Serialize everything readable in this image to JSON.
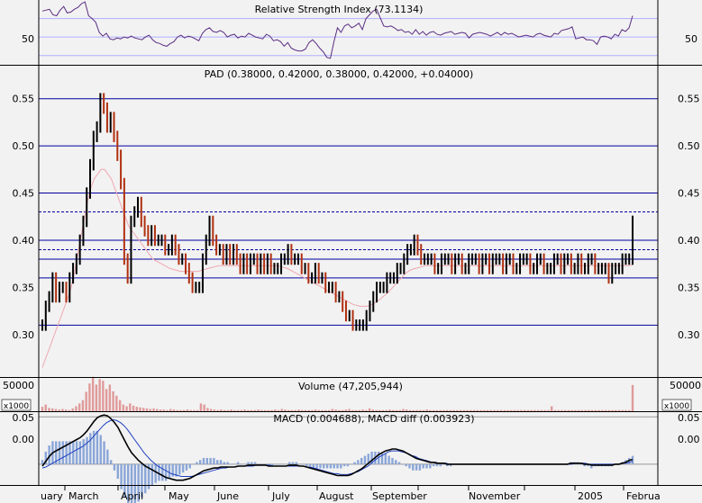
{
  "chart_data": {
    "type": "line",
    "x_labels": [
      "uary",
      "March",
      "April",
      "May",
      "June",
      "July",
      "August",
      "September",
      "November",
      "2005",
      "Februa"
    ],
    "panels": {
      "rsi": {
        "title": "Relative Strength Index (73.1134)",
        "ytick_labels": [
          "50"
        ],
        "ylim": [
          20,
          90
        ],
        "reference_lines": [
          50,
          70,
          30
        ],
        "series": [
          {
            "values": [
              78,
              79,
              80,
              74,
              73,
              79,
              83,
              76,
              77,
              80,
              82,
              86,
              88,
              73,
              70,
              66,
              55,
              51,
              54,
              48,
              47,
              49,
              48,
              50,
              49,
              51,
              49,
              48,
              47,
              50,
              52,
              47,
              44,
              43,
              41,
              40,
              43,
              45,
              50,
              52,
              49,
              51,
              50,
              48,
              46,
              54,
              58,
              60,
              56,
              55,
              57,
              55,
              50,
              52,
              53,
              49,
              51,
              50,
              54,
              52,
              50,
              49,
              48,
              53,
              51,
              46,
              47,
              45,
              40,
              44,
              38,
              36,
              35,
              35,
              37,
              44,
              47,
              43,
              38,
              34,
              28,
              27,
              45,
              60,
              55,
              62,
              64,
              60,
              62,
              65,
              58,
              70,
              74,
              78,
              80,
              71,
              62,
              61,
              62,
              60,
              57,
              58,
              55,
              56,
              53,
              58,
              53,
              56,
              52,
              55,
              56,
              53,
              52,
              54,
              55,
              56,
              53,
              54,
              55,
              54,
              49,
              53,
              54,
              55,
              54,
              53,
              51,
              53,
              55,
              52,
              55,
              53,
              54,
              52,
              50,
              51,
              52,
              51,
              50,
              53,
              54,
              52,
              51,
              50,
              54,
              53,
              57,
              58,
              59,
              61,
              48,
              49,
              50,
              47,
              47,
              46,
              42,
              50,
              51,
              50,
              48,
              53,
              51,
              58,
              56,
              60,
              73
            ]
          }
        ]
      },
      "price": {
        "title": "PAD (0.38000, 0.42000, 0.38000, 0.42000, +0.04000)",
        "ytick_labels": [
          "0.55",
          "0.50",
          "0.45",
          "0.40",
          "0.35",
          "0.30"
        ],
        "ylim": [
          0.255,
          0.585
        ],
        "hlines": [
          0.31,
          0.36,
          0.38,
          0.4,
          0.45,
          0.5,
          0.55
        ],
        "dashed_hlines": [
          0.39,
          0.43
        ],
        "close": [
          0.31,
          0.33,
          0.34,
          0.36,
          0.34,
          0.35,
          0.35,
          0.34,
          0.36,
          0.37,
          0.38,
          0.4,
          0.42,
          0.45,
          0.48,
          0.51,
          0.52,
          0.55,
          0.54,
          0.52,
          0.53,
          0.51,
          0.49,
          0.46,
          0.38,
          0.36,
          0.42,
          0.43,
          0.44,
          0.42,
          0.41,
          0.4,
          0.41,
          0.4,
          0.4,
          0.4,
          0.39,
          0.39,
          0.4,
          0.39,
          0.38,
          0.38,
          0.37,
          0.36,
          0.35,
          0.35,
          0.35,
          0.38,
          0.4,
          0.42,
          0.4,
          0.39,
          0.39,
          0.38,
          0.39,
          0.38,
          0.39,
          0.38,
          0.37,
          0.38,
          0.37,
          0.38,
          0.38,
          0.37,
          0.38,
          0.37,
          0.38,
          0.37,
          0.37,
          0.37,
          0.38,
          0.38,
          0.39,
          0.38,
          0.38,
          0.38,
          0.37,
          0.37,
          0.36,
          0.36,
          0.37,
          0.36,
          0.36,
          0.35,
          0.35,
          0.35,
          0.34,
          0.34,
          0.33,
          0.32,
          0.32,
          0.31,
          0.31,
          0.31,
          0.31,
          0.32,
          0.33,
          0.34,
          0.35,
          0.35,
          0.35,
          0.36,
          0.36,
          0.36,
          0.37,
          0.37,
          0.38,
          0.39,
          0.39,
          0.4,
          0.39,
          0.38,
          0.38,
          0.38,
          0.38,
          0.37,
          0.37,
          0.38,
          0.38,
          0.38,
          0.37,
          0.38,
          0.38,
          0.37,
          0.37,
          0.38,
          0.38,
          0.38,
          0.37,
          0.38,
          0.38,
          0.37,
          0.38,
          0.38,
          0.38,
          0.37,
          0.38,
          0.38,
          0.37,
          0.37,
          0.38,
          0.38,
          0.38,
          0.37,
          0.37,
          0.38,
          0.38,
          0.37,
          0.37,
          0.37,
          0.38,
          0.38,
          0.37,
          0.38,
          0.38,
          0.37,
          0.37,
          0.38,
          0.37,
          0.37,
          0.38,
          0.38,
          0.37,
          0.37,
          0.37,
          0.37,
          0.36,
          0.37,
          0.37,
          0.37,
          0.38,
          0.38,
          0.38,
          0.42
        ],
        "moving_average": [
          0.265,
          0.275,
          0.285,
          0.295,
          0.305,
          0.315,
          0.325,
          0.335,
          0.345,
          0.36,
          0.38,
          0.4,
          0.42,
          0.44,
          0.455,
          0.465,
          0.47,
          0.475,
          0.475,
          0.47,
          0.465,
          0.455,
          0.445,
          0.435,
          0.425,
          0.415,
          0.41,
          0.405,
          0.4,
          0.395,
          0.39,
          0.385,
          0.38,
          0.378,
          0.376,
          0.374,
          0.372,
          0.37,
          0.369,
          0.368,
          0.367,
          0.367,
          0.367,
          0.367,
          0.367,
          0.367,
          0.368,
          0.369,
          0.37,
          0.371,
          0.372,
          0.373,
          0.373,
          0.373,
          0.373,
          0.373,
          0.373,
          0.373,
          0.373,
          0.373,
          0.373,
          0.373,
          0.373,
          0.373,
          0.373,
          0.373,
          0.373,
          0.373,
          0.373,
          0.372,
          0.371,
          0.37,
          0.368,
          0.366,
          0.364,
          0.362,
          0.36,
          0.358,
          0.356,
          0.354,
          0.352,
          0.35,
          0.348,
          0.346,
          0.344,
          0.342,
          0.34,
          0.338,
          0.336,
          0.334,
          0.332,
          0.331,
          0.33,
          0.33,
          0.33,
          0.331,
          0.333,
          0.335,
          0.338,
          0.341,
          0.344,
          0.348,
          0.352,
          0.356,
          0.36,
          0.364,
          0.367,
          0.369,
          0.37,
          0.371,
          0.372,
          0.373,
          0.373,
          0.373,
          0.373,
          0.373,
          0.373,
          0.373,
          0.373,
          0.373,
          0.373,
          0.373,
          0.373,
          0.373,
          0.373,
          0.373,
          0.373,
          0.373,
          0.373,
          0.373,
          0.373,
          0.373,
          0.373,
          0.373,
          0.373,
          0.373,
          0.373,
          0.373,
          0.373,
          0.373,
          0.373,
          0.373,
          0.373,
          0.373,
          0.373,
          0.373,
          0.373,
          0.373,
          0.373,
          0.373,
          0.373,
          0.373,
          0.373,
          0.373,
          0.373,
          0.373,
          0.373,
          0.373,
          0.373,
          0.373,
          0.373,
          0.373,
          0.373,
          0.373,
          0.373,
          0.373,
          0.373,
          0.373,
          0.373,
          0.373,
          0.373,
          0.374
        ]
      },
      "volume": {
        "title": "Volume (47,205,944)",
        "ytick_labels": [
          "50000"
        ],
        "unit_label": "x1000",
        "ylim": [
          0,
          60000
        ],
        "values": [
          8000,
          12000,
          6000,
          5000,
          4000,
          3000,
          4000,
          3000,
          2000,
          5000,
          9000,
          14000,
          20000,
          35000,
          50000,
          62000,
          48000,
          58000,
          55000,
          40000,
          48000,
          36000,
          28000,
          20000,
          12000,
          9000,
          14000,
          10000,
          8000,
          7000,
          6000,
          5000,
          4000,
          5000,
          4000,
          3000,
          3000,
          2000,
          4000,
          3000,
          2000,
          2000,
          2000,
          3000,
          2000,
          2000,
          2000,
          14000,
          12000,
          6000,
          4000,
          3000,
          2000,
          3000,
          2000,
          2000,
          3000,
          2000,
          2000,
          2000,
          3000,
          2000,
          2000,
          2000,
          3000,
          2000,
          2000,
          2000,
          2000,
          3000,
          2000,
          4000,
          3000,
          2000,
          2000,
          2000,
          3000,
          2000,
          2000,
          2000,
          2000,
          3000,
          2000,
          2000,
          2000,
          2000,
          4000,
          3000,
          2000,
          2000,
          3000,
          4000,
          2000,
          2000,
          2000,
          3000,
          2000,
          5000,
          3000,
          2000,
          2000,
          2000,
          2000,
          3000,
          2000,
          2000,
          2000,
          4000,
          3000,
          2000,
          2000,
          2000,
          2000,
          2000,
          3000,
          2000,
          2000,
          2000,
          2000,
          2000,
          2000,
          2000,
          2000,
          2000,
          2000,
          2000,
          2000,
          2000,
          2000,
          2000,
          2000,
          2000,
          2000,
          2000,
          2000,
          2000,
          2000,
          2000,
          2000,
          2000,
          2000,
          2000,
          2000,
          2000,
          2000,
          2000,
          2000,
          2000,
          2000,
          2000,
          2000,
          9000,
          2000,
          2000,
          2000,
          2000,
          2000,
          2000,
          2000,
          2000,
          2000,
          2000,
          2000,
          2000,
          2000,
          2000,
          2000,
          2000,
          2000,
          2000,
          2000,
          2000,
          2000,
          2000,
          2000,
          47205
        ]
      },
      "macd": {
        "title": "MACD (0.004688), MACD diff (0.003923)",
        "ytick_labels": [
          "0.05",
          "0.00"
        ],
        "ylim": [
          -0.022,
          0.055
        ],
        "macd": [
          -0.002,
          0.003,
          0.008,
          0.012,
          0.014,
          0.016,
          0.018,
          0.02,
          0.022,
          0.024,
          0.026,
          0.028,
          0.031,
          0.035,
          0.04,
          0.045,
          0.049,
          0.051,
          0.052,
          0.051,
          0.048,
          0.044,
          0.039,
          0.032,
          0.025,
          0.018,
          0.012,
          0.008,
          0.004,
          0.001,
          -0.002,
          -0.004,
          -0.006,
          -0.008,
          -0.01,
          -0.012,
          -0.014,
          -0.015,
          -0.016,
          -0.017,
          -0.017,
          -0.017,
          -0.016,
          -0.015,
          -0.013,
          -0.011,
          -0.009,
          -0.007,
          -0.006,
          -0.005,
          -0.004,
          -0.004,
          -0.003,
          -0.003,
          -0.003,
          -0.003,
          -0.003,
          -0.002,
          -0.002,
          -0.002,
          -0.001,
          -0.001,
          -0.001,
          -0.001,
          -0.001,
          -0.001,
          -0.002,
          -0.002,
          -0.002,
          -0.002,
          -0.002,
          -0.002,
          -0.001,
          -0.001,
          -0.001,
          -0.002,
          -0.002,
          -0.003,
          -0.004,
          -0.005,
          -0.006,
          -0.007,
          -0.008,
          -0.009,
          -0.01,
          -0.011,
          -0.012,
          -0.012,
          -0.012,
          -0.012,
          -0.011,
          -0.009,
          -0.007,
          -0.005,
          -0.002,
          0.001,
          0.004,
          0.007,
          0.01,
          0.012,
          0.014,
          0.015,
          0.016,
          0.016,
          0.015,
          0.014,
          0.012,
          0.01,
          0.008,
          0.006,
          0.005,
          0.004,
          0.003,
          0.002,
          0.002,
          0.001,
          0.001,
          0.001,
          0.0,
          0.0,
          0.0,
          0.0,
          0.0,
          0.0,
          0.0,
          0.0,
          0.0,
          0.0,
          0.0,
          0.0,
          0.0,
          0.0,
          0.0,
          0.0,
          0.0,
          0.0,
          0.0,
          0.0,
          0.0,
          0.0,
          0.0,
          0.0,
          0.0,
          0.0,
          0.0,
          0.0,
          0.0,
          0.0,
          0.0,
          0.0,
          0.0,
          0.0,
          0.0,
          0.0,
          0.001,
          0.001,
          0.001,
          0.001,
          0.0,
          0.0,
          -0.001,
          -0.001,
          -0.001,
          -0.001,
          -0.001,
          -0.001,
          -0.001,
          0.0,
          0.0,
          0.001,
          0.002,
          0.004,
          0.005
        ],
        "signal": [
          -0.004,
          -0.003,
          -0.001,
          0.001,
          0.003,
          0.005,
          0.007,
          0.009,
          0.011,
          0.013,
          0.015,
          0.017,
          0.019,
          0.022,
          0.025,
          0.029,
          0.033,
          0.037,
          0.041,
          0.044,
          0.046,
          0.047,
          0.046,
          0.044,
          0.041,
          0.037,
          0.032,
          0.027,
          0.022,
          0.017,
          0.012,
          0.008,
          0.004,
          0.001,
          -0.002,
          -0.004,
          -0.006,
          -0.008,
          -0.01,
          -0.011,
          -0.012,
          -0.013,
          -0.013,
          -0.013,
          -0.013,
          -0.012,
          -0.011,
          -0.01,
          -0.009,
          -0.008,
          -0.007,
          -0.006,
          -0.005,
          -0.004,
          -0.004,
          -0.003,
          -0.003,
          -0.003,
          -0.002,
          -0.002,
          -0.002,
          -0.002,
          -0.002,
          -0.001,
          -0.001,
          -0.001,
          -0.001,
          -0.001,
          -0.002,
          -0.002,
          -0.002,
          -0.002,
          -0.002,
          -0.002,
          -0.002,
          -0.002,
          -0.002,
          -0.002,
          -0.003,
          -0.003,
          -0.004,
          -0.005,
          -0.006,
          -0.007,
          -0.008,
          -0.009,
          -0.01,
          -0.01,
          -0.011,
          -0.011,
          -0.011,
          -0.01,
          -0.009,
          -0.008,
          -0.006,
          -0.004,
          -0.002,
          0.001,
          0.004,
          0.007,
          0.009,
          0.011,
          0.013,
          0.014,
          0.014,
          0.014,
          0.013,
          0.012,
          0.011,
          0.009,
          0.008,
          0.006,
          0.005,
          0.004,
          0.003,
          0.002,
          0.002,
          0.001,
          0.001,
          0.001,
          0.0,
          0.0,
          0.0,
          0.0,
          0.0,
          0.0,
          0.0,
          0.0,
          0.0,
          0.0,
          0.0,
          0.0,
          0.0,
          0.0,
          0.0,
          0.0,
          0.0,
          0.0,
          0.0,
          0.0,
          0.0,
          0.0,
          0.0,
          0.0,
          0.0,
          0.0,
          0.0,
          0.0,
          0.0,
          0.0,
          0.0,
          0.0,
          0.0,
          0.0,
          0.0,
          0.0,
          0.0,
          0.001,
          0.001,
          0.001,
          0.001,
          0.0,
          0.0,
          0.0,
          0.0,
          0.0,
          0.0,
          0.0,
          0.0,
          0.0,
          0.0,
          0.001,
          0.001,
          0.002,
          0.003
        ]
      }
    }
  }
}
